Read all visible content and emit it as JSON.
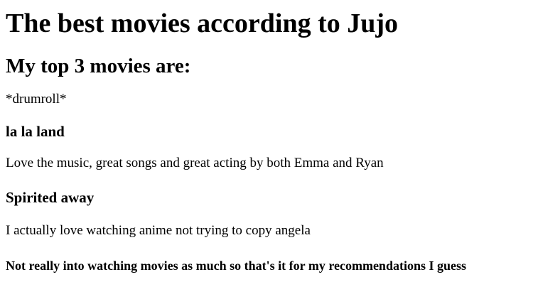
{
  "header": {
    "title": "The best movies according to Jujo",
    "subtitle": "My top 3 movies are:"
  },
  "intro": {
    "text": "*drumroll*"
  },
  "movies": [
    {
      "title": "la la land",
      "description": "Love the music, great songs and great acting by both Emma and Ryan"
    },
    {
      "title": "Spirited away",
      "description": "I actually love watching anime not trying to copy angela"
    }
  ],
  "footer": {
    "note": "Not really into watching movies as much so that's it for my recommendations I guess"
  }
}
